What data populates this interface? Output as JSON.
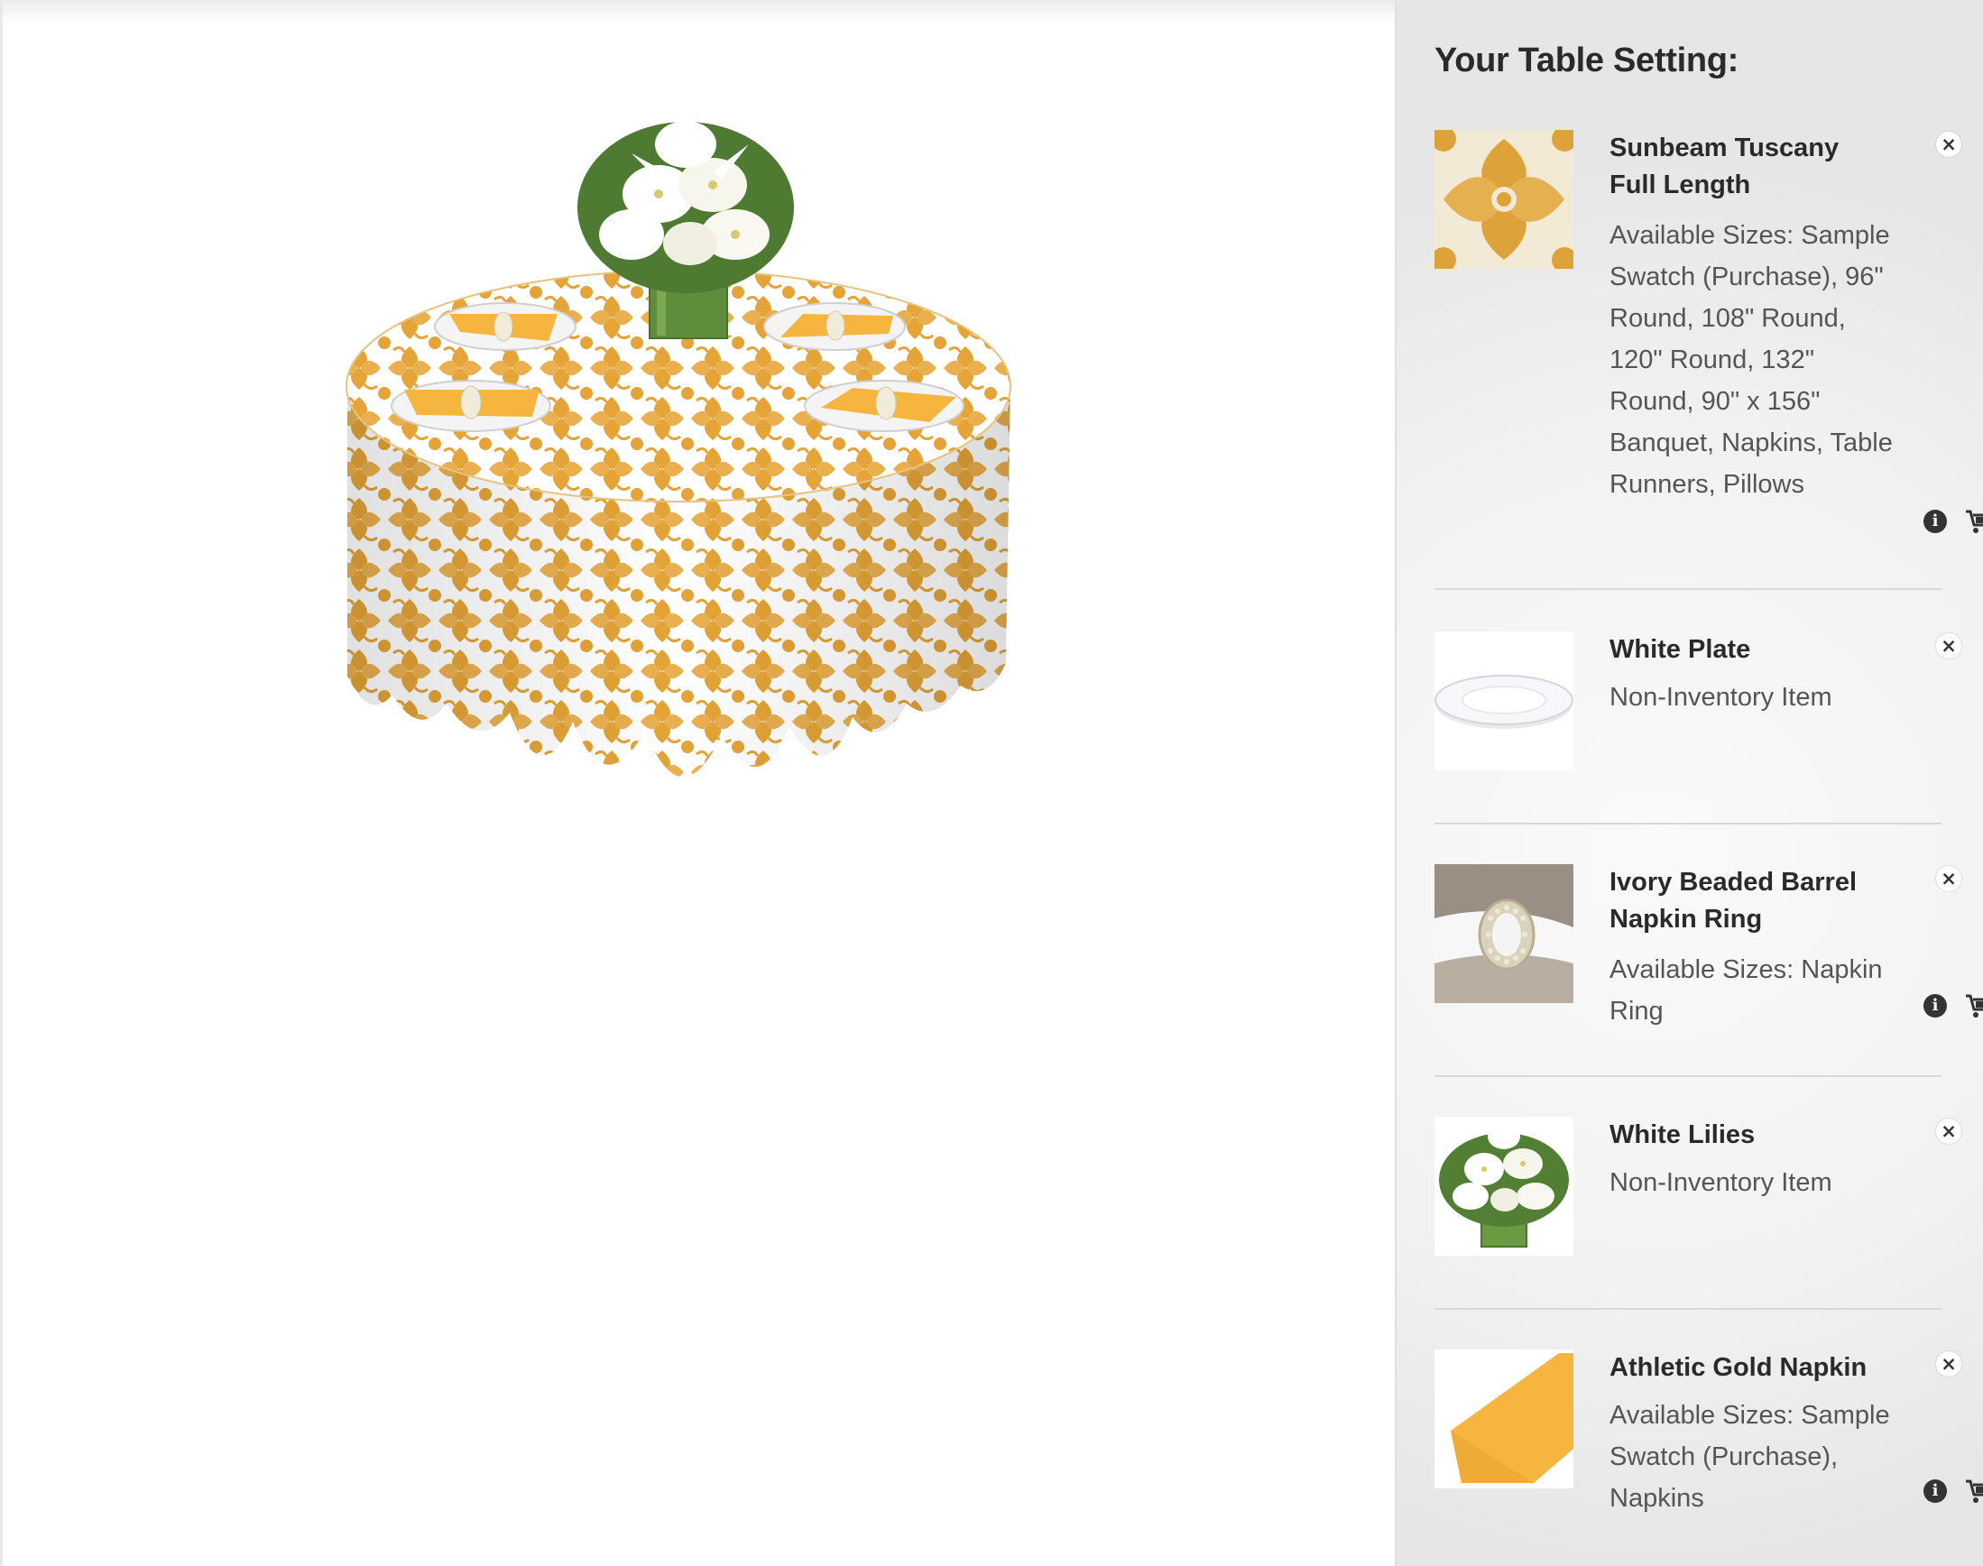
{
  "panel": {
    "title": "Your Table Setting:",
    "items": [
      {
        "name": "Sunbeam Tuscany Full Length",
        "description": "Available Sizes: Sample Swatch (Purchase), 96\" Round, 108\" Round, 120\" Round, 132\" Round, 90\" x 156\" Banquet, Napkins, Table Runners, Pillows",
        "thumb_icon": "damask-swatch-icon",
        "has_info": true,
        "has_cart": true
      },
      {
        "name": "White Plate",
        "description": "Non-Inventory Item",
        "thumb_icon": "plate-icon",
        "has_info": false,
        "has_cart": false
      },
      {
        "name": "Ivory Beaded Barrel Napkin Ring",
        "description": "Available Sizes: Napkin Ring",
        "thumb_icon": "napkin-ring-icon",
        "has_info": true,
        "has_cart": true
      },
      {
        "name": "White Lilies",
        "description": "Non-Inventory Item",
        "thumb_icon": "lilies-icon",
        "has_info": false,
        "has_cart": false
      },
      {
        "name": "Athletic Gold Napkin",
        "description": "Available Sizes: Sample Swatch (Purchase), Napkins",
        "thumb_icon": "gold-napkin-icon",
        "has_info": true,
        "has_cart": true
      }
    ]
  },
  "icons": {
    "remove": "×",
    "info": "i",
    "cart": "add-to-cart-icon"
  },
  "colors": {
    "gold": "#e2a33a",
    "napkin_gold": "#f5b53f",
    "panel_bg": "#f2f2f2",
    "title_text": "#2a2a2a",
    "body_text": "#555555"
  }
}
